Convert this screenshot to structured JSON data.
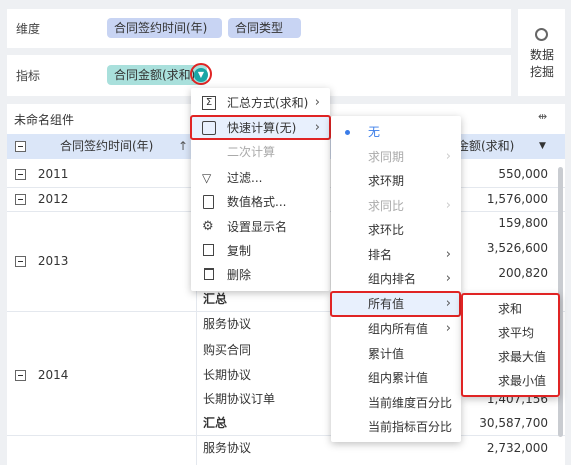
{
  "fields": {
    "dimension_label": "维度",
    "dimension_chips": [
      "合同签约时间(年)",
      "合同类型"
    ],
    "metric_label": "指标",
    "metric_chip": "合同金额(求和)",
    "data_mining_label": "数据\n挖掘"
  },
  "component": {
    "title": "未命名组件",
    "expand_icon": "expand-arrows-icon"
  },
  "table": {
    "headers": {
      "col1": "合同签约时间(年)",
      "col3": "金额(求和)"
    },
    "years": [
      "2011",
      "2012",
      "2013",
      "2014"
    ],
    "col2_cells": [
      "汇总",
      "服务协议",
      "购买合同",
      "长期协议",
      "长期协议订单",
      "汇总",
      "服务协议"
    ],
    "values": [
      "550,000",
      "1,576,000",
      "159,800",
      "3,526,600",
      "200,820",
      "1,407,156",
      "30,587,700",
      "2,732,000"
    ]
  },
  "menu1": {
    "items": [
      {
        "label": "汇总方式(求和)",
        "icon": "sigma-icon",
        "arrow": "›"
      },
      {
        "label": "快速计算(无)",
        "icon": "calculator-icon",
        "arrow": "›"
      },
      {
        "label": "二次计算",
        "icon": "",
        "arrow": ""
      },
      {
        "label": "过滤...",
        "icon": "filter-icon",
        "arrow": ""
      },
      {
        "label": "数值格式...",
        "icon": "number-format-icon",
        "arrow": ""
      },
      {
        "label": "设置显示名",
        "icon": "gear-icon",
        "arrow": ""
      },
      {
        "label": "复制",
        "icon": "copy-icon",
        "arrow": ""
      },
      {
        "label": "删除",
        "icon": "trash-icon",
        "arrow": ""
      }
    ]
  },
  "menu2": {
    "items": [
      {
        "label": "无",
        "selected": true,
        "arrow": ""
      },
      {
        "label": "求同期",
        "disabled": true,
        "arrow": "›"
      },
      {
        "label": "求环期",
        "arrow": ""
      },
      {
        "label": "求同比",
        "disabled": true,
        "arrow": "›"
      },
      {
        "label": "求环比",
        "arrow": ""
      },
      {
        "label": "排名",
        "arrow": "›"
      },
      {
        "label": "组内排名",
        "arrow": "›"
      },
      {
        "label": "所有值",
        "arrow": "›"
      },
      {
        "label": "组内所有值",
        "arrow": "›"
      },
      {
        "label": "累计值",
        "arrow": ""
      },
      {
        "label": "组内累计值",
        "arrow": ""
      },
      {
        "label": "当前维度百分比",
        "arrow": ""
      },
      {
        "label": "当前指标百分比",
        "arrow": ""
      }
    ]
  },
  "menu3": {
    "items": [
      "求和",
      "求平均",
      "求最大值",
      "求最小值"
    ]
  },
  "colors": {
    "accent": "#3a7ce8",
    "highlight_border": "#e02424",
    "header_bg": "#dbe6f8"
  }
}
